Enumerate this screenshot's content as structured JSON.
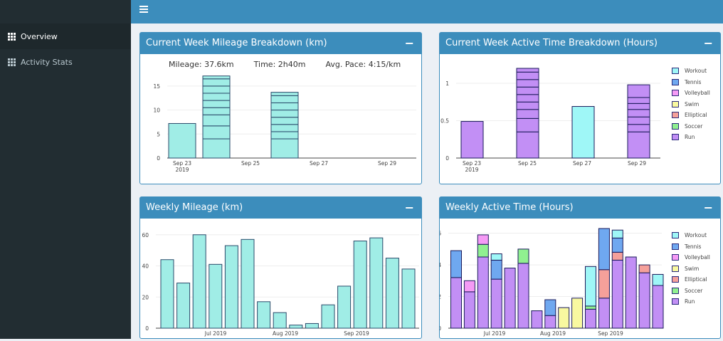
{
  "sidebar": {
    "items": [
      {
        "label": "Overview",
        "active": true
      },
      {
        "label": "Activity Stats",
        "active": false
      }
    ]
  },
  "header": {
    "menu_icon": "hamburger-icon"
  },
  "colors": {
    "header_blue": "#3c8dbc",
    "sidebar_dark": "#222d32",
    "Workout": "#9ff7f7",
    "Tennis": "#6fa8f0",
    "Volleyball": "#f59af5",
    "Swim": "#f8f8a0",
    "Elliptical": "#f5a09a",
    "Soccer": "#90f090",
    "Run": "#c28ff5",
    "mileage_bar": "#a0ede6"
  },
  "boxes": {
    "mileage_breakdown": {
      "title": "Current Week Mileage Breakdown (km)",
      "stats": {
        "mileage": "Mileage: 37.6km",
        "time": "Time: 2h40m",
        "pace": "Avg. Pace: 4:15/km"
      }
    },
    "time_breakdown": {
      "title": "Current Week Active Time Breakdown (Hours)"
    },
    "weekly_mileage": {
      "title": "Weekly Mileage (km)"
    },
    "weekly_time": {
      "title": "Weekly Active Time (Hours)"
    }
  },
  "legend": [
    "Workout",
    "Tennis",
    "Volleyball",
    "Swim",
    "Elliptical",
    "Soccer",
    "Run"
  ],
  "chart_data": [
    {
      "type": "bar",
      "name": "mileage_breakdown",
      "x_ticks": [
        "Sep 23\n2019",
        "Sep 25",
        "Sep 27",
        "Sep 29"
      ],
      "y_ticks": [
        0,
        5,
        10,
        15
      ],
      "ylim": [
        0,
        17.5
      ],
      "bars": [
        {
          "day": 0,
          "segments": [
            7.2
          ]
        },
        {
          "day": 1,
          "segments": [
            4,
            2.7,
            2.3,
            1.5,
            1.5,
            1.5,
            1.5,
            1.5,
            0.6
          ]
        },
        {
          "day": 3,
          "segments": [
            4,
            1.5,
            1.5,
            1.5,
            1.5,
            1.5,
            1.5,
            0.7
          ]
        }
      ]
    },
    {
      "type": "bar",
      "name": "time_breakdown",
      "x_ticks": [
        "Sep 23\n2019",
        "Sep 25",
        "Sep 27",
        "Sep 29"
      ],
      "y_ticks": [
        0,
        0.5,
        1
      ],
      "ylim": [
        0,
        1.2
      ],
      "bars": [
        {
          "day": 0,
          "segments": [
            {
              "type": "Run",
              "v": 0.49
            }
          ]
        },
        {
          "day": 1,
          "segments": [
            {
              "type": "Run",
              "v": 0.35
            },
            {
              "type": "Run",
              "v": 0.18
            },
            {
              "type": "Run",
              "v": 0.12
            },
            {
              "type": "Run",
              "v": 0.1
            },
            {
              "type": "Run",
              "v": 0.1
            },
            {
              "type": "Run",
              "v": 0.1
            },
            {
              "type": "Run",
              "v": 0.1
            },
            {
              "type": "Run",
              "v": 0.1
            },
            {
              "type": "Run",
              "v": 0.05
            }
          ]
        },
        {
          "day": 2,
          "segments": [
            {
              "type": "Workout",
              "v": 0.69
            }
          ]
        },
        {
          "day": 3,
          "segments": [
            {
              "type": "Run",
              "v": 0.35
            },
            {
              "type": "Run",
              "v": 0.1
            },
            {
              "type": "Run",
              "v": 0.1
            },
            {
              "type": "Run",
              "v": 0.1
            },
            {
              "type": "Run",
              "v": 0.08
            },
            {
              "type": "Run",
              "v": 0.08
            },
            {
              "type": "Run",
              "v": 0.17
            }
          ]
        }
      ]
    },
    {
      "type": "bar",
      "name": "weekly_mileage",
      "x_ticks": [
        "Jul 2019",
        "Aug 2019",
        "Sep 2019"
      ],
      "y_ticks": [
        0,
        20,
        40,
        60
      ],
      "ylim": [
        0,
        64
      ],
      "values": [
        44,
        29,
        60,
        41,
        53,
        57,
        17,
        10,
        2,
        3,
        15,
        27,
        56,
        58,
        45,
        38
      ]
    },
    {
      "type": "bar",
      "name": "weekly_time",
      "x_ticks": [
        "Jul 2019",
        "Aug 2019",
        "Sep 2019"
      ],
      "y_ticks": [
        0,
        2,
        4,
        6
      ],
      "ylim": [
        0,
        6.3
      ],
      "weeks": [
        [
          {
            "type": "Run",
            "v": 3.2
          },
          {
            "type": "Tennis",
            "v": 1.7
          }
        ],
        [
          {
            "type": "Run",
            "v": 2.3
          },
          {
            "type": "Volleyball",
            "v": 0.7
          }
        ],
        [
          {
            "type": "Run",
            "v": 4.5
          },
          {
            "type": "Soccer",
            "v": 0.8
          },
          {
            "type": "Volleyball",
            "v": 0.6
          }
        ],
        [
          {
            "type": "Run",
            "v": 3.1
          },
          {
            "type": "Tennis",
            "v": 1.2
          },
          {
            "type": "Workout",
            "v": 0.4
          }
        ],
        [
          {
            "type": "Run",
            "v": 3.8
          }
        ],
        [
          {
            "type": "Run",
            "v": 4.1
          },
          {
            "type": "Soccer",
            "v": 0.9
          }
        ],
        [
          {
            "type": "Run",
            "v": 1.1
          }
        ],
        [
          {
            "type": "Run",
            "v": 0.8
          },
          {
            "type": "Tennis",
            "v": 1.0
          }
        ],
        [
          {
            "type": "Swim",
            "v": 1.3
          }
        ],
        [
          {
            "type": "Swim",
            "v": 1.9
          }
        ],
        [
          {
            "type": "Run",
            "v": 1.2
          },
          {
            "type": "Soccer",
            "v": 0.2
          },
          {
            "type": "Workout",
            "v": 2.5
          }
        ],
        [
          {
            "type": "Run",
            "v": 1.9
          },
          {
            "type": "Elliptical",
            "v": 1.8
          },
          {
            "type": "Tennis",
            "v": 2.6
          }
        ],
        [
          {
            "type": "Run",
            "v": 4.3
          },
          {
            "type": "Elliptical",
            "v": 0.5
          },
          {
            "type": "Tennis",
            "v": 0.9
          },
          {
            "type": "Workout",
            "v": 0.5
          }
        ],
        [
          {
            "type": "Run",
            "v": 4.5
          }
        ],
        [
          {
            "type": "Run",
            "v": 3.5
          },
          {
            "type": "Elliptical",
            "v": 0.5
          }
        ],
        [
          {
            "type": "Run",
            "v": 2.7
          },
          {
            "type": "Workout",
            "v": 0.7
          }
        ]
      ]
    }
  ]
}
